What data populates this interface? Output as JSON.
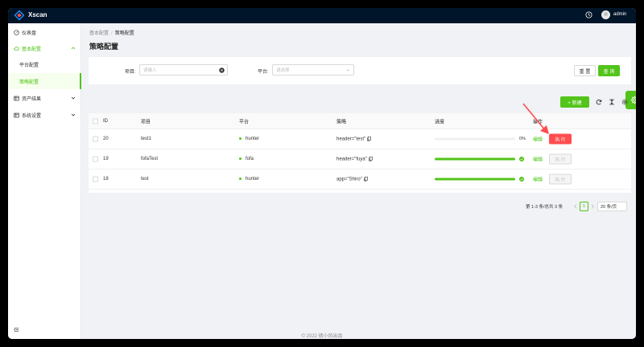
{
  "app": {
    "title": "Xscan",
    "username": "admin"
  },
  "sidebar": {
    "items": [
      {
        "label": "仪表盘"
      },
      {
        "label": "基本配置"
      },
      {
        "label": "平台配置"
      },
      {
        "label": "策略配置"
      },
      {
        "label": "资产结果"
      },
      {
        "label": "系统设置"
      }
    ]
  },
  "breadcrumb": {
    "parent": "基本配置",
    "separator": "/",
    "current": "策略配置"
  },
  "page": {
    "title": "策略配置"
  },
  "search": {
    "project_label": "项目:",
    "project_placeholder": "请输入",
    "platform_label": "平台:",
    "platform_placeholder": "请选择",
    "reset_label": "重 置",
    "query_label": "查 询"
  },
  "toolbar": {
    "new_label": "+ 新建"
  },
  "table": {
    "columns": [
      "ID",
      "项目",
      "平台",
      "策略",
      "进度",
      "操作"
    ],
    "rows": [
      {
        "id": "20",
        "project": "test1",
        "platform": "hunter",
        "policy": "header=\"test\"",
        "progress": 0,
        "progress_text": "0%",
        "edit": "编辑",
        "exec": "执 行"
      },
      {
        "id": "19",
        "project": "fofaTest",
        "platform": "fofa",
        "policy": "header=\"fuya\"",
        "progress": 100,
        "progress_text": "",
        "edit": "编辑",
        "exec": "执 行"
      },
      {
        "id": "18",
        "project": "test",
        "platform": "hunter",
        "policy": "app=\"Shiro\"",
        "progress": 100,
        "progress_text": "",
        "edit": "编辑",
        "exec": "执 行"
      }
    ]
  },
  "pagination": {
    "summary": "第 1-3 条/总共 3 条",
    "current_page": "1",
    "page_size": "20 条/页"
  },
  "footer": {
    "text": "© 2022 德小风出品"
  },
  "colors": {
    "accent": "#52c41a",
    "danger": "#ff4d4f",
    "header": "#001529"
  }
}
